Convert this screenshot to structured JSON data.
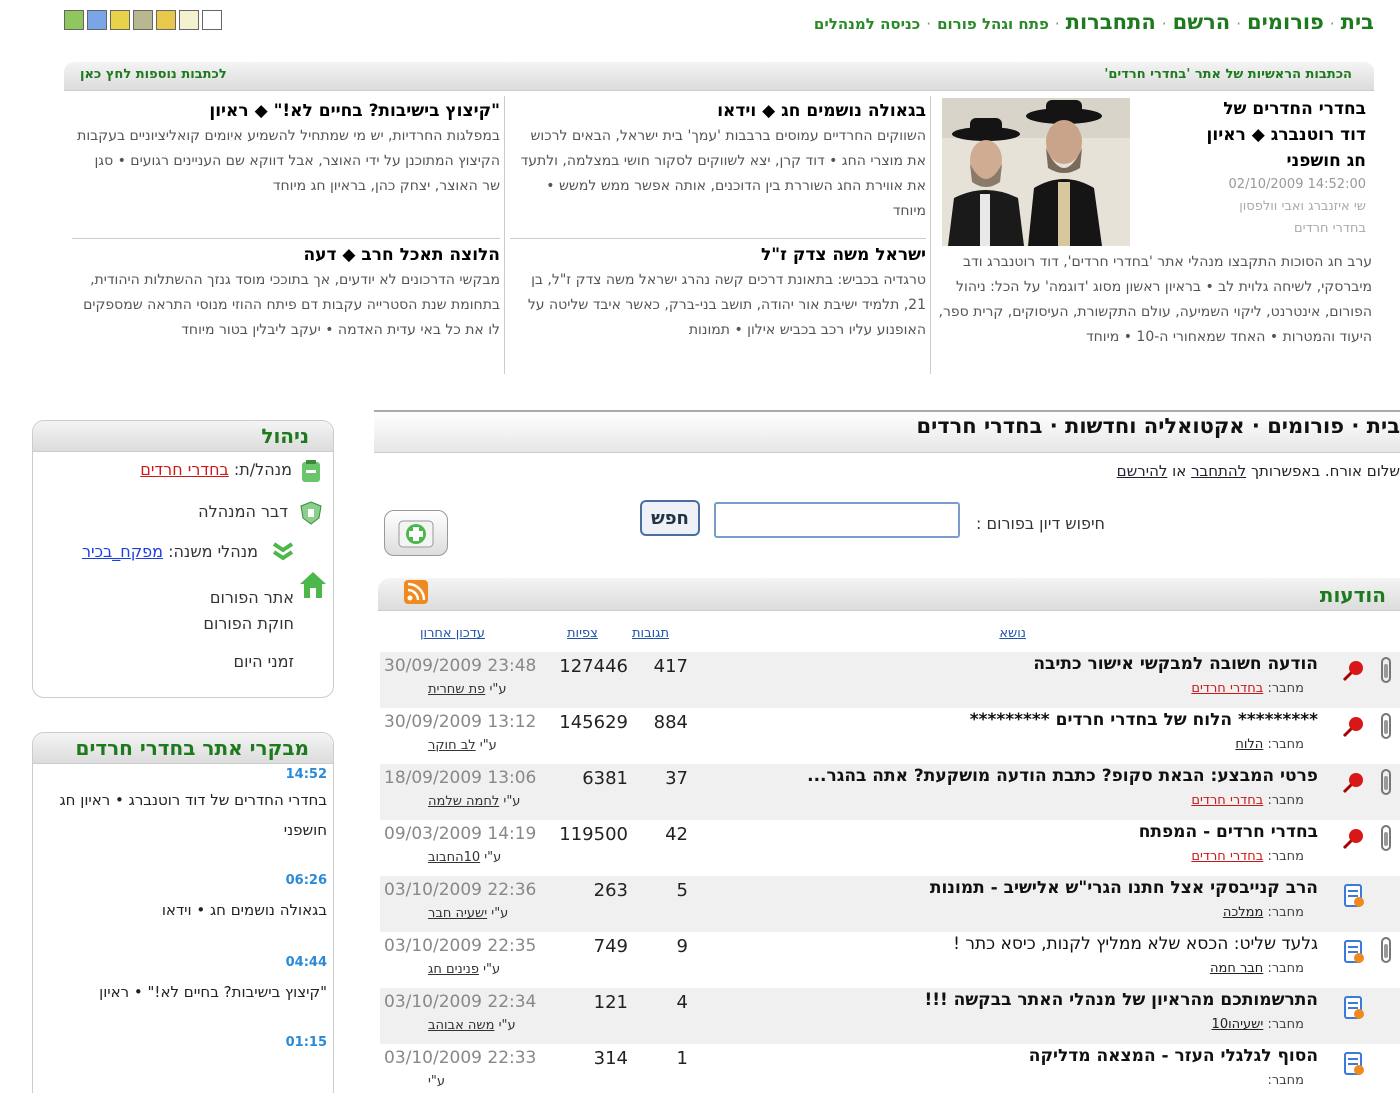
{
  "top": {
    "swatch_colors": [
      "#8fc65e",
      "#7aa6e8",
      "#e8d24a",
      "#b8b890",
      "#e8c84a",
      "#f4f0d0",
      "#ffffff"
    ],
    "nav": [
      {
        "label": "בית",
        "size": "big"
      },
      {
        "label": "פורומים",
        "size": "big"
      },
      {
        "label": "הרשם",
        "size": "big"
      },
      {
        "label": "התחברות",
        "size": "big"
      },
      {
        "label": "פתח וגהל פורום",
        "size": "small"
      },
      {
        "label": "כניסה למנהלים",
        "size": "small"
      }
    ]
  },
  "featured": {
    "header_right": "הכתבות הראשיות של אתר 'בחדרי חרדים'",
    "header_left": "לכתבות נוספות לחץ כאן",
    "main": {
      "title_lines": [
        "בחדרי החדרים של",
        "דוד רוטנברג ◆ ראיון",
        "חג חושפני"
      ],
      "date": "14:52:00 02/10/2009",
      "author_lines": [
        "שי איזנברג ואבי וולפסון",
        "בחדרי חרדים"
      ],
      "body": "ערב חג הסוכות התקבצו מנהלי אתר 'בחדרי חרדים', דוד רוטנברג ודב מיברסקי, לשיחה גלוית לב • בראיון ראשון מסוג 'דוגמה' על הכל: ניהול הפורום, אינטרנט, ליקוי השמיעה, עולם התקשורת, העיסוקים, קרית ספר, היעוד והמטרות • האחד שמאחורי ה-10 • מיוחד"
    },
    "items": [
      {
        "title": "בגאולה נושמים חג ◆ וידאו",
        "body": "השווקים החרדיים עמוסים ברבבות 'עמך' בית ישראל, הבאים לרכוש את מוצרי החג • דוד קרן, יצא לשווקים לסקור חושי במצלמה, ולתעד את אווירת החג השוררת בין הדוכנים, אותה אפשר ממש למשש • מיוחד"
      },
      {
        "title": "\"קיצוץ בישיבות? בחיים לא!\" ◆ ראיון",
        "body": "במפלגות החרדיות, יש מי שמתחיל להשמיע איומים קואליציוניים בעקבות הקיצוץ המתוכנן על ידי האוצר, אבל דווקא שם העניינים רגועים • סגן שר האוצר, יצחק כהן, בראיון חג מיוחד"
      },
      {
        "title": "ישראל משה צדק ז\"ל",
        "body": "טרגדיה בכביש: בתאונת דרכים קשה נהרג ישראל משה צדק ז\"ל, בן 21, תלמיד ישיבת אור יהודה, תושב בני-ברק, כאשר איבד שליטה על האופנוע עליו רכב בכביש אילון • תמונות"
      },
      {
        "title": "הלוצה תאכל חרב ◆ דעה",
        "body": "מבקשי הדרכונים לא יודעים, אך בתוככי מוסד גנזך ההשתלות היהודית, בתחומת שנת הסטרייה עקבות דם פיתח ההוזי מנוסי התראה שמספקים לו את כל באי עדית האדמה • יעקב ליבלין בטור מיוחד"
      }
    ]
  },
  "forum": {
    "breadcrumb": "בית · פורומים · אקטואליה וחדשות · בחדרי חרדים",
    "welcome_prefix": "שלום אורח. באפשרותך ",
    "login_link": "להתחבר",
    "welcome_mid": " או ",
    "register_link": "להירשם",
    "search_label": "חיפוש דיון בפורום :",
    "search_value": "",
    "search_button": "חפש",
    "messages_title": "הודעות",
    "rss_label": "RSS",
    "columns": {
      "subject": "נושא",
      "replies": "תגובות",
      "views": "צפיות",
      "last": "עדכון אחרון"
    },
    "author_prefix": "מחבר:",
    "last_by_prefix": "ע\"י",
    "rows": [
      {
        "title": "הודעה חשובה למבקשי אישור כתיבה",
        "author": "בחדרי חרדים",
        "author_red": true,
        "replies": "417",
        "views": "127446",
        "date": "30/09/2009 23:48",
        "last_by": "פת שחרית",
        "pinned": true,
        "bold": true
      },
      {
        "title": "********* הלוח של בחדרי חרדים *********",
        "author": "הלוח",
        "author_red": false,
        "replies": "884",
        "views": "145629",
        "date": "30/09/2009 13:12",
        "last_by": "לב חוקר",
        "pinned": true,
        "bold": true
      },
      {
        "title": "פרטי המבצע: הבאת סקופ? כתבת הודעה מושקעת? אתה בהגר...",
        "author": "בחדרי חרדים",
        "author_red": true,
        "replies": "37",
        "views": "6381",
        "date": "18/09/2009 13:06",
        "last_by": "לחמה שלמה",
        "pinned": true,
        "bold": true
      },
      {
        "title": "בחדרי חרדים - המפתח",
        "author": "בחדרי חרדים",
        "author_red": true,
        "replies": "42",
        "views": "119500",
        "date": "09/03/2009 14:19",
        "last_by": "10החבוב",
        "pinned": true,
        "bold": true
      },
      {
        "title": "הרב קנייבסקי אצל חתנו הגרי\"ש אלישיב - תמונות",
        "author": "ממלכה",
        "author_red": false,
        "replies": "5",
        "views": "263",
        "date": "03/10/2009 22:36",
        "last_by": "ישעיה חבר",
        "pinned": false,
        "bold": true
      },
      {
        "title": "גלעד שליט: הכסא שלא ממליץ לקנות, כיסא כתר !",
        "author": "חבר חמה",
        "author_red": false,
        "replies": "9",
        "views": "749",
        "date": "03/10/2009 22:35",
        "last_by": "פנינים חג",
        "pinned": false,
        "bold": false
      },
      {
        "title": "התרשמותכם מהראיון של מנהלי האתר בבקשה !!!",
        "author": "ישעיהו10",
        "author_red": false,
        "replies": "4",
        "views": "121",
        "date": "03/10/2009 22:34",
        "last_by": "משה אבוהב",
        "pinned": false,
        "bold": true
      },
      {
        "title": "הסוף לגלגלי העזר - המצאה מדליקה",
        "author": "",
        "author_red": false,
        "replies": "1",
        "views": "314",
        "date": "03/10/2009 22:33",
        "last_by": "",
        "pinned": false,
        "bold": true
      }
    ]
  },
  "sidebar": {
    "admin_title": "ניהול",
    "admin_label": "מנהל/ת:",
    "admin_name": "בחדרי חרדים",
    "admin_talk": "דבר המנהלה",
    "deputies_label": "מנהלי משנה:",
    "deputies_name": "מפקח_בכיר",
    "site_link": "אתר הפורום",
    "rules_link": "חוקת הפורום",
    "times_link": "זמני היום",
    "visitors_title": "מבקרי אתר בחדרי חרדים",
    "visits": [
      {
        "time": "14:52",
        "text": "בחדרי החדרים של דוד רוטנברג • ראיון חג חושפני"
      },
      {
        "time": "06:26",
        "text": "בגאולה נושמים חג • וידאו"
      },
      {
        "time": "04:44",
        "text": "\"קיצוץ בישיבות? בחיים לא!\" • ראיון"
      },
      {
        "time": "01:15",
        "text": ""
      }
    ]
  }
}
